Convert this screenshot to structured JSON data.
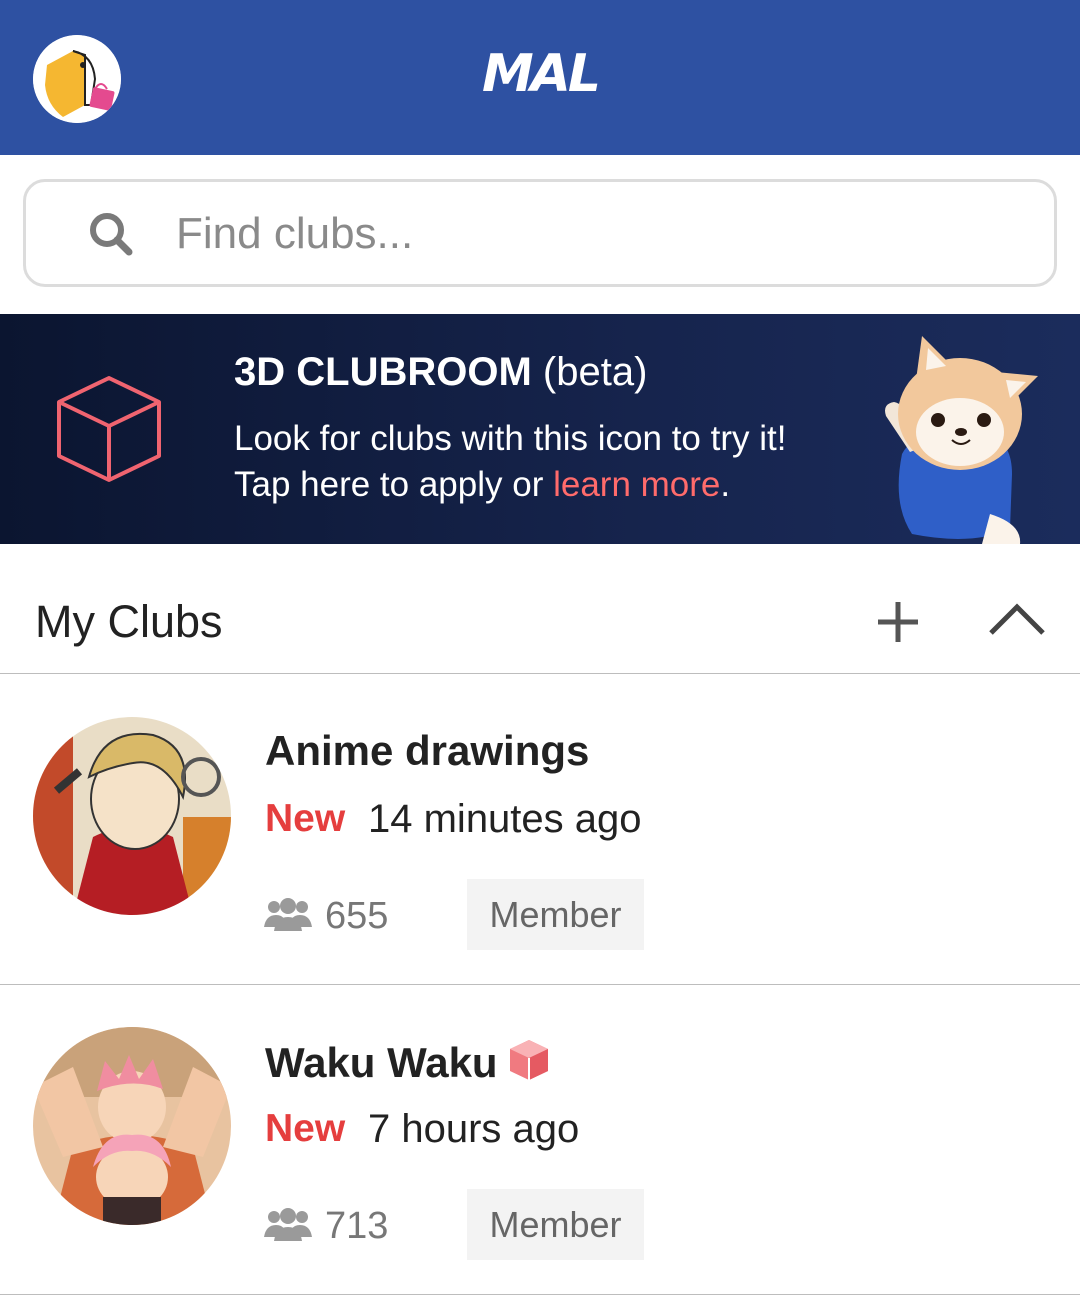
{
  "header": {
    "logo_text": "MAL"
  },
  "search": {
    "placeholder": "Find clubs..."
  },
  "banner": {
    "title_bold": "3D CLUBROOM",
    "title_rest": " (beta)",
    "line1": "Look for clubs with this icon to try it!",
    "line2_prefix": "Tap here to apply or ",
    "line2_link": "learn more",
    "line2_suffix": "."
  },
  "my_clubs": {
    "title": "My Clubs"
  },
  "clubs": [
    {
      "name": "Anime drawings",
      "new_label": "New",
      "time": "14 minutes ago",
      "members": "655",
      "role": "Member",
      "has_3d_icon": false
    },
    {
      "name": "Waku Waku",
      "new_label": "New",
      "time": "7 hours ago",
      "members": "713",
      "role": "Member",
      "has_3d_icon": true
    }
  ],
  "colors": {
    "header_bg": "#2e51a2",
    "accent_red": "#e53e3e",
    "link_coral": "#ff6b6b",
    "banner_bg": "#0b1530"
  },
  "icons": {
    "search": "search-icon",
    "cube": "cube-icon",
    "add": "plus-icon",
    "collapse": "chevron-up-icon",
    "members": "users-icon"
  }
}
